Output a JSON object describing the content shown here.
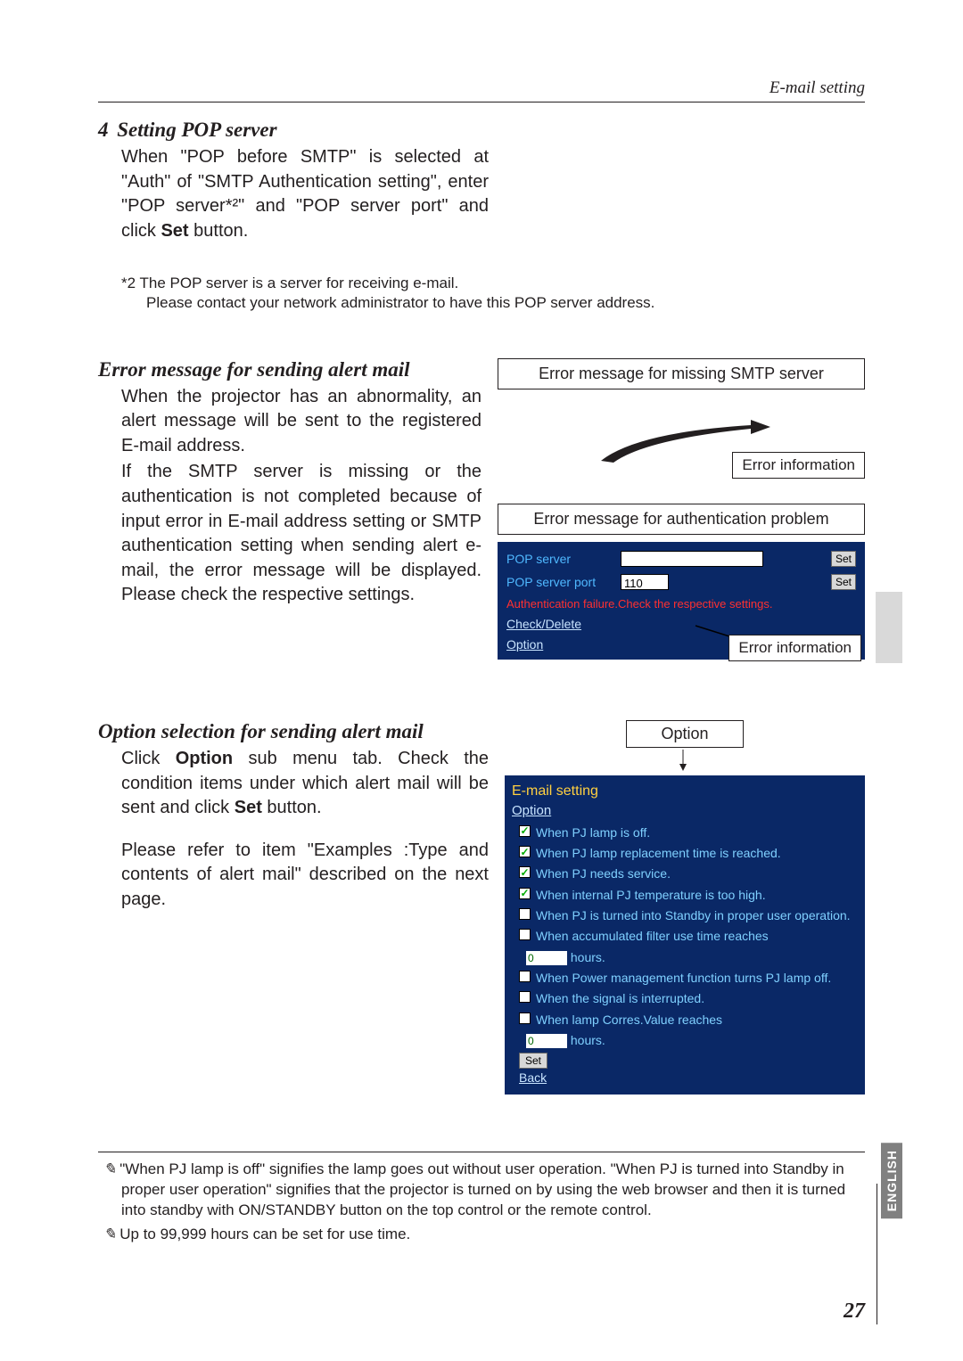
{
  "header": {
    "section_label": "E-mail setting"
  },
  "section4": {
    "num": "4",
    "title": "Setting POP server",
    "body_html": "When \"POP before SMTP\" is selected at \"Auth\" of \"SMTP Authentication setting\", enter \"POP server*²\" and \"POP server port\" and click <b class='s'>Set</b> button.",
    "footnote_lead": "*2 The POP server is a server for receiving e-mail.",
    "footnote_rest": "Please contact your network administrator to have this POP server address."
  },
  "error_section": {
    "title": "Error message for sending alert mail",
    "p1": "When the projector has an abnormality, an alert message will be sent to the registered E-mail address.",
    "p2": "If the SMTP server is missing or the authentication is not completed because of input error in E-mail address setting or SMTP authentication setting when sending alert e-mail, the error message will be displayed. Please check the respective settings.",
    "box1": "Error message for missing SMTP server",
    "callout1": "Error information",
    "box2": "Error message for authentication problem",
    "panel": {
      "row1_label": "POP server",
      "row1_value": "",
      "row1_btn": "Set",
      "row2_label": "POP server port",
      "row2_value": "110",
      "row2_btn": "Set",
      "auth_fail": "Authentication failure.Check the respective settings.",
      "link1": "Check/Delete",
      "link2": "Option"
    },
    "callout2": "Error information"
  },
  "option_section": {
    "title": "Option selection for sending alert mail",
    "p1_html": "Click <b class='s'>Option</b> sub menu tab. Check the condition items under which alert mail will be sent and click <b class='s'>Set</b> button.",
    "p2": "Please refer to item \"Examples :Type and contents of alert mail\" described on the next page.",
    "top_label": "Option",
    "panel": {
      "hdr1": "E-mail setting",
      "hdr2": "Option",
      "items": [
        {
          "checked": true,
          "text": "When PJ lamp is off."
        },
        {
          "checked": true,
          "text": "When PJ lamp replacement time is reached."
        },
        {
          "checked": true,
          "text": "When PJ needs service."
        },
        {
          "checked": true,
          "text": "When internal PJ temperature is too high."
        },
        {
          "checked": false,
          "text": "When PJ is turned into Standby in proper user operation."
        },
        {
          "checked": false,
          "text": "When accumulated filter use time reaches"
        }
      ],
      "hours1_value": "0",
      "hours1_unit": "hours.",
      "items2": [
        {
          "checked": false,
          "text": "When Power management function turns PJ lamp off."
        },
        {
          "checked": false,
          "text": "When the signal is interrupted."
        },
        {
          "checked": false,
          "text": "When lamp Corres.Value reaches"
        }
      ],
      "hours2_value": "0",
      "hours2_unit": "hours.",
      "set_btn": "Set",
      "back": "Back"
    }
  },
  "notes": {
    "n1": "\"When PJ lamp is off\" signifies the lamp goes out without user operation. \"When PJ is turned into Standby  in proper user operation\" signifies that the projector is turned on by using the web browser and then it is turned into standby with ON/STANDBY button on the top control or the remote control.",
    "n2": "Up to 99,999 hours can be set for use time."
  },
  "page": {
    "num": "27",
    "lang": "ENGLISH"
  }
}
